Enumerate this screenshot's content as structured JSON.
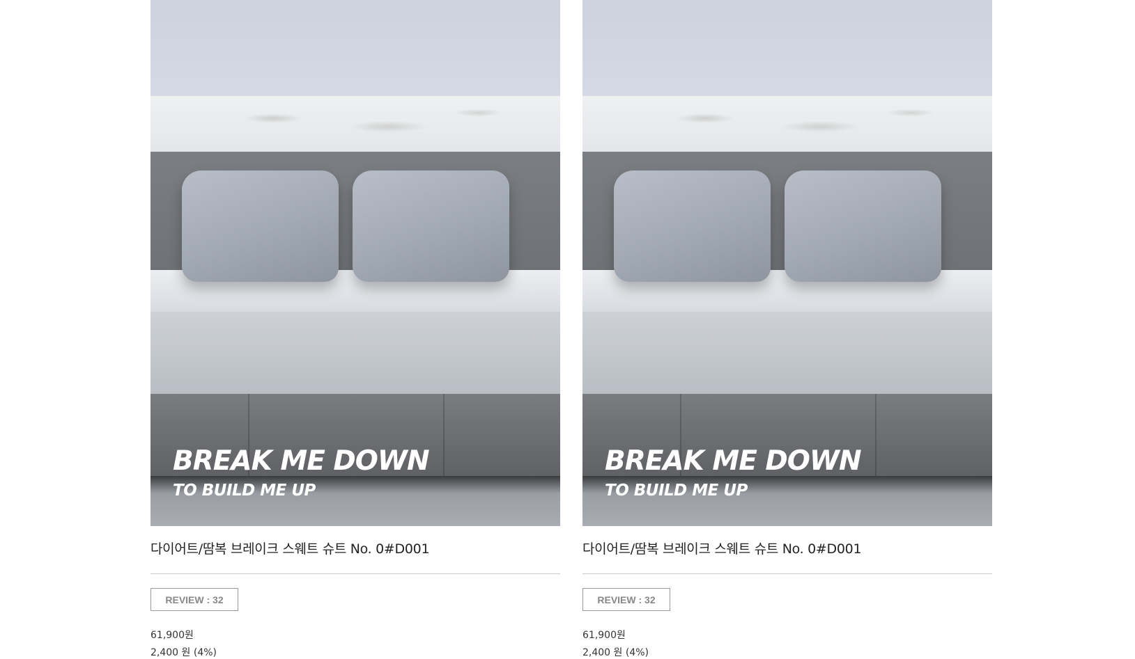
{
  "products": [
    {
      "headline": "BREAK ME DOWN",
      "subline": "TO BUILD ME UP",
      "title": "다이어트/땀복 브레이크 스웨트 슈트 No. 0#D001",
      "review": "REVIEW : 32",
      "price": "61,900원",
      "discount": "2,400 원 (4%)"
    },
    {
      "headline": "BREAK ME DOWN",
      "subline": "TO BUILD ME UP",
      "title": "다이어트/땀복 브레이크 스웨트 슈트 No. 0#D001",
      "review": "REVIEW : 32",
      "price": "61,900원",
      "discount": "2,400 원 (4%)"
    }
  ]
}
